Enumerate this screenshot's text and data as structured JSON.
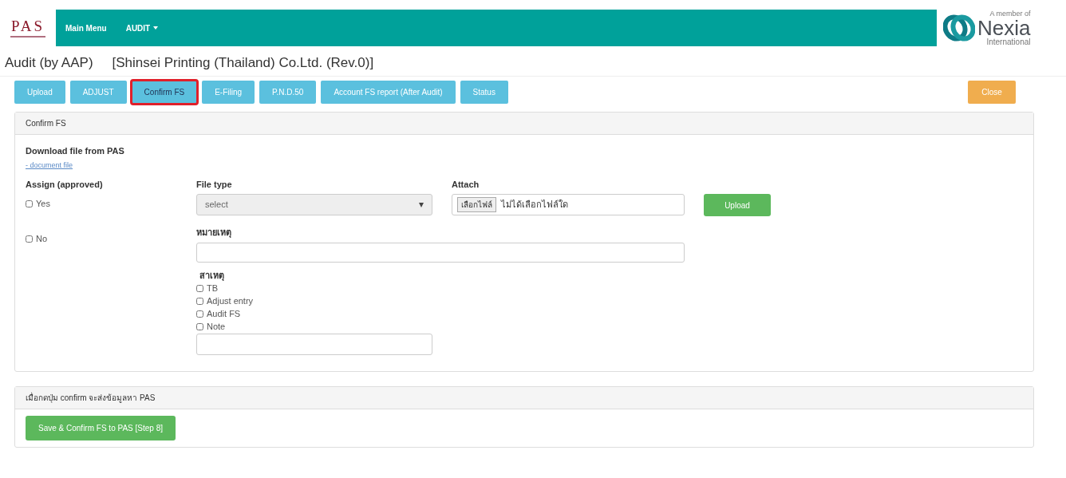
{
  "navbar": {
    "brand": "PAS",
    "menu": [
      {
        "label": "Main Menu",
        "dropdown": false
      },
      {
        "label": "AUDIT",
        "dropdown": true
      }
    ],
    "partner": {
      "small": "A member of",
      "name": "Nexia",
      "sub": "International"
    }
  },
  "heading": {
    "title": "Audit (by AAP)",
    "company": "[Shinsei Printing (Thailand) Co.Ltd. (Rev.0)]"
  },
  "tabs": [
    {
      "label": "Upload",
      "selected": false
    },
    {
      "label": "ADJUST",
      "selected": false
    },
    {
      "label": "Confirm FS",
      "selected": true
    },
    {
      "label": "E-Filing",
      "selected": false
    },
    {
      "label": "P.N.D.50",
      "selected": false
    },
    {
      "label": "Account FS report (After Audit)",
      "selected": false
    },
    {
      "label": "Status",
      "selected": false
    }
  ],
  "close_button": "Close",
  "confirm_panel": {
    "title": "Confirm FS",
    "download_label": "Download file from PAS",
    "download_link": "- document file",
    "assign_label": "Assign (approved)",
    "assign_options": [
      {
        "label": "Yes",
        "checked": false
      },
      {
        "label": "No",
        "checked": false
      }
    ],
    "file_type_label": "File type",
    "file_type_value": "select",
    "attach_label": "Attach",
    "choose_file_button": "เลือกไฟล์",
    "file_status": "ไม่ได้เลือกไฟล์ใด",
    "upload_button": "Upload",
    "remark_label": "หมายเหตุ",
    "cause_label": "สาเหตุ",
    "causes": [
      {
        "label": "TB",
        "checked": false
      },
      {
        "label": "Adjust entry",
        "checked": false
      },
      {
        "label": "Audit FS",
        "checked": false
      },
      {
        "label": "Note",
        "checked": false
      }
    ]
  },
  "submit_panel": {
    "title": "เมื่อกดปุ่ม confirm จะส่งข้อมูลหา PAS",
    "button": "Save & Confirm FS to PAS [Step 8]"
  }
}
